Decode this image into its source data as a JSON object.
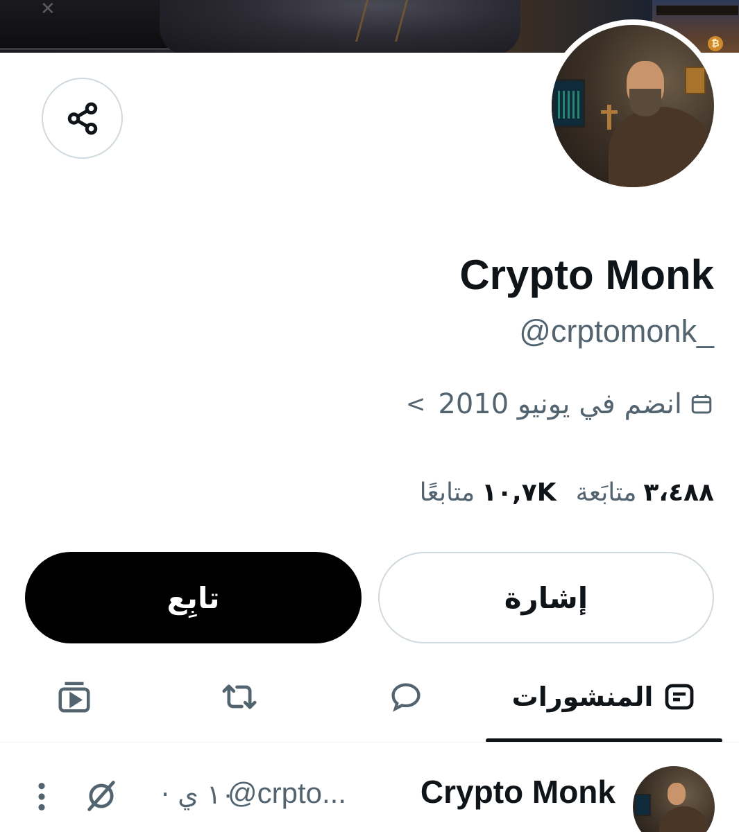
{
  "profile": {
    "name": "Crypto Monk",
    "handle": "@crptomonk_",
    "joined": "انضم في يونيو 2010",
    "joined_chevron": "<",
    "following_count": "٣،٤٨٨",
    "following_label": "متابَعة",
    "followers_count": "١٠,٧K",
    "followers_label": "متابعًا"
  },
  "actions": {
    "follow_label": "تابِع",
    "mention_label": "إشارة"
  },
  "tabs": {
    "posts_label": "المنشورات"
  },
  "post": {
    "name": "Crypto Monk",
    "handle": "@crpto...",
    "time": "١٠ ي ·"
  },
  "banner": {
    "coin_glyph": "₿"
  },
  "icons": {
    "share": "share-icon",
    "calendar": "calendar-icon",
    "posts": "posts-icon",
    "replies": "reply-icon",
    "reposts": "repost-icon",
    "media": "media-icon",
    "grok": "grok-icon",
    "more": "more-icon"
  }
}
